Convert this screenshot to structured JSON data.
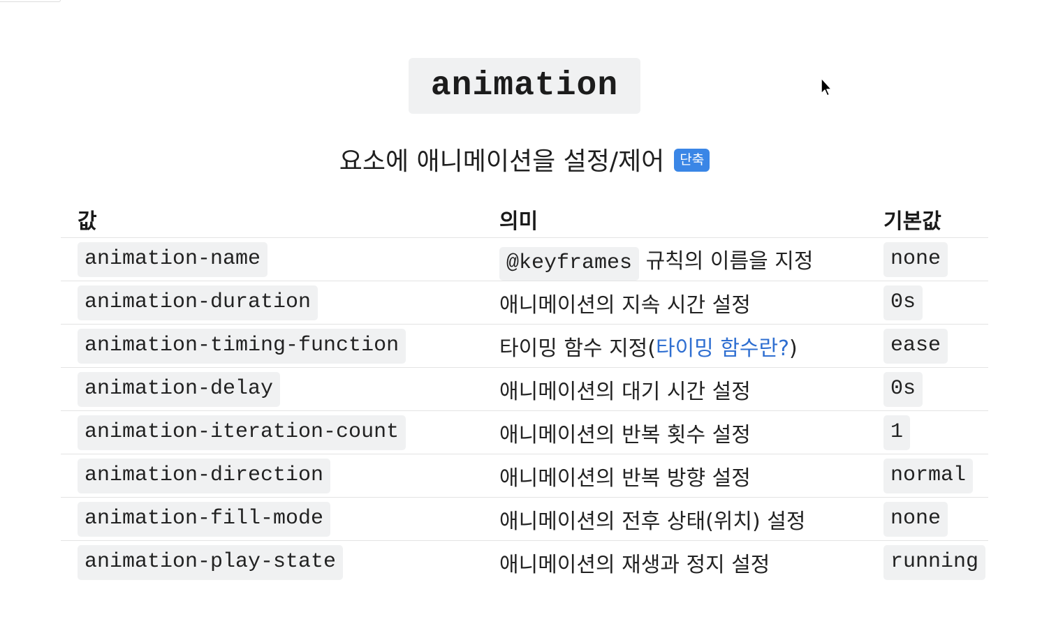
{
  "title": "animation",
  "subtitle": "요소에 애니메이션을 설정/제어",
  "badge": "단축",
  "table": {
    "headers": [
      "값",
      "의미",
      "기본값"
    ],
    "rows": [
      {
        "value": "animation-name",
        "meaning_code": "@keyframes",
        "meaning_text": " 규칙의 이름을 지정",
        "default": "none"
      },
      {
        "value": "animation-duration",
        "meaning_text": "애니메이션의 지속 시간 설정",
        "default": "0s"
      },
      {
        "value": "animation-timing-function",
        "meaning_text": "타이밍 함수 지정(",
        "meaning_link": "타이밍 함수란?",
        "meaning_suffix": ")",
        "default": "ease"
      },
      {
        "value": "animation-delay",
        "meaning_text": "애니메이션의 대기 시간 설정",
        "default": "0s"
      },
      {
        "value": "animation-iteration-count",
        "meaning_text": "애니메이션의 반복 횟수 설정",
        "default": "1"
      },
      {
        "value": "animation-direction",
        "meaning_text": "애니메이션의 반복 방향 설정",
        "default": "normal"
      },
      {
        "value": "animation-fill-mode",
        "meaning_text": "애니메이션의 전후 상태(위치) 설정",
        "default": "none"
      },
      {
        "value": "animation-play-state",
        "meaning_text": "애니메이션의 재생과 정지 설정",
        "default": "running"
      }
    ]
  },
  "colors": {
    "badge": "#3a86e6",
    "link": "#2f6fd1",
    "code_bg": "#f0f1f2"
  },
  "icons": {
    "cursor": "mouse-pointer-icon"
  }
}
